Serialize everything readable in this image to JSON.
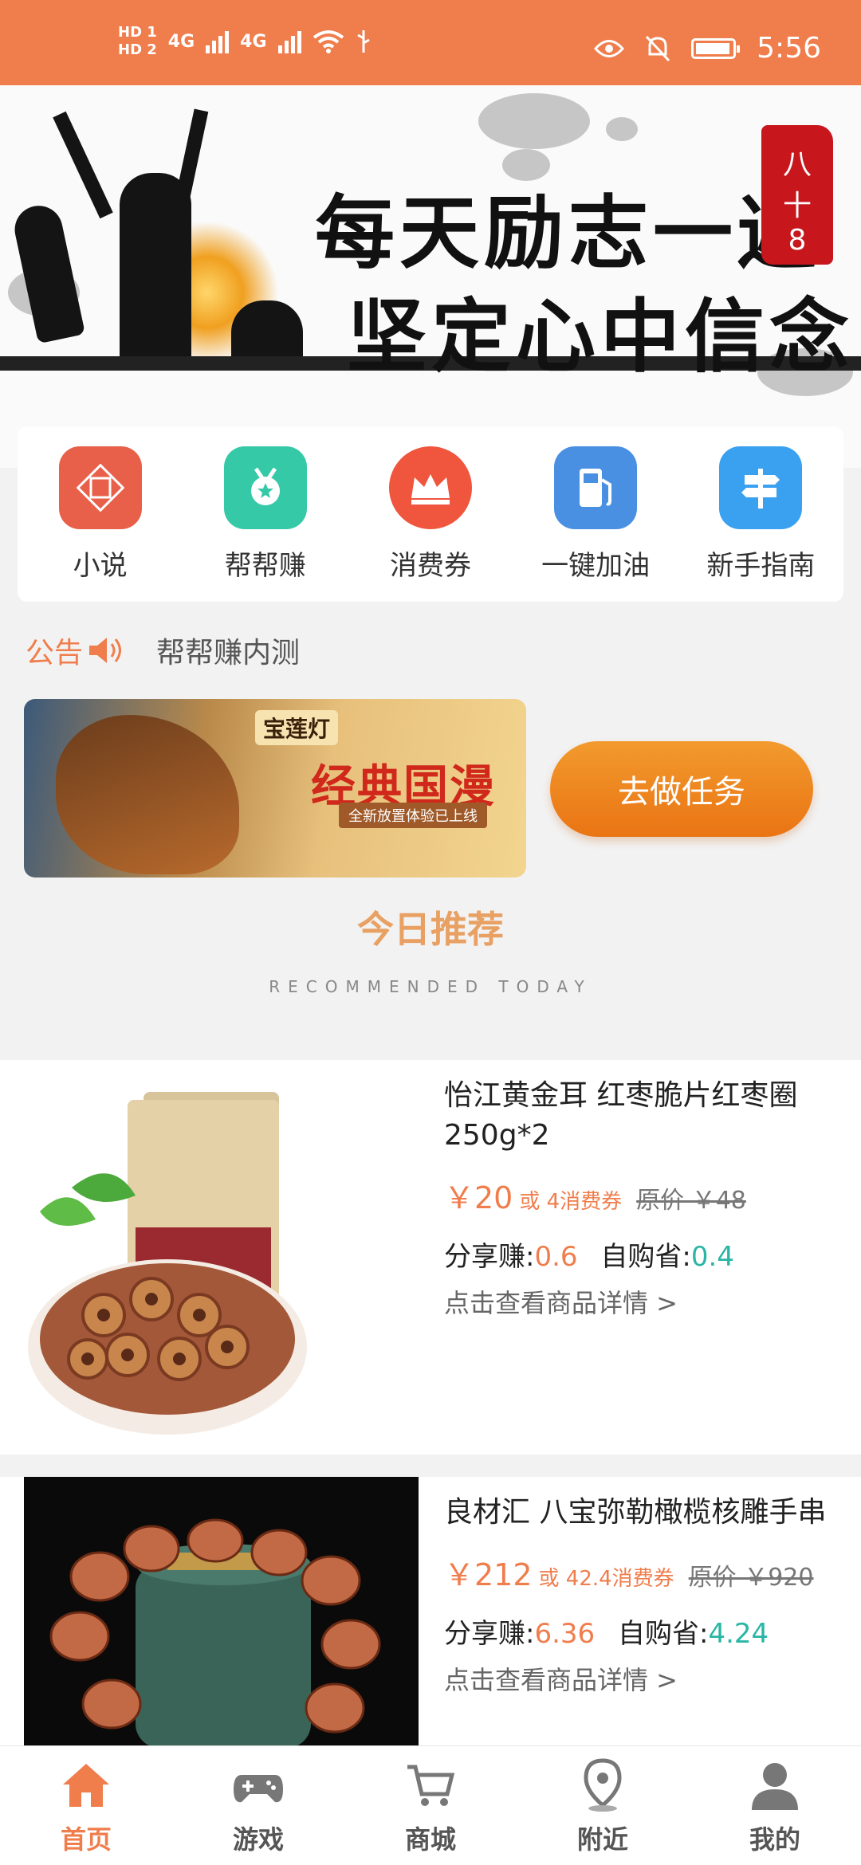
{
  "status_bar": {
    "hd1": "HD 1",
    "hd2": "HD 2",
    "net1": "4G",
    "net2": "4G",
    "time": "5:56"
  },
  "banner": {
    "line1": "每天励志一遍",
    "line2": "坚定心中信念"
  },
  "quick_menu": [
    {
      "label": "小说",
      "icon": "novel-icon",
      "color": "#e9604a"
    },
    {
      "label": "帮帮赚",
      "icon": "medal-icon",
      "color": "#35c9a8"
    },
    {
      "label": "消费券",
      "icon": "crown-icon",
      "color": "#f0553d"
    },
    {
      "label": "一键加油",
      "icon": "fuel-icon",
      "color": "#4a90e2"
    },
    {
      "label": "新手指南",
      "icon": "signpost-icon",
      "color": "#3aa0f0"
    }
  ],
  "notice": {
    "tag": "公告",
    "text": "帮帮赚内测"
  },
  "promo": {
    "logo": "宝莲灯",
    "title": "经典国漫",
    "subtitle": "全新放置体验已上线",
    "button": "去做任务"
  },
  "recommend": {
    "title": "今日推荐",
    "subtitle": "RECOMMENDED TODAY"
  },
  "products": [
    {
      "title": "怡江黄金耳 红枣脆片红枣圈250g*2",
      "price": "￥20",
      "voucher": "或 4消费券",
      "original": "原价 ￥48",
      "share_label": "分享赚:",
      "share_value": "0.6",
      "self_label": "自购省:",
      "self_value": "0.4",
      "detail": "点击查看商品详情 >"
    },
    {
      "title": "良材汇 八宝弥勒橄榄核雕手串",
      "price": "￥212",
      "voucher": "或 42.4消费券",
      "original": "原价 ￥920",
      "share_label": "分享赚:",
      "share_value": "6.36",
      "self_label": "自购省:",
      "self_value": "4.24",
      "detail": "点击查看商品详情 >"
    }
  ],
  "tabbar": [
    {
      "label": "首页",
      "icon": "home-icon",
      "active": true
    },
    {
      "label": "游戏",
      "icon": "gamepad-icon",
      "active": false
    },
    {
      "label": "商城",
      "icon": "cart-icon",
      "active": false
    },
    {
      "label": "附近",
      "icon": "location-icon",
      "active": false
    },
    {
      "label": "我的",
      "icon": "user-icon",
      "active": false
    }
  ],
  "colors": {
    "accent": "#f07d4c",
    "green": "#29b6a5",
    "button": "#ea7413"
  }
}
